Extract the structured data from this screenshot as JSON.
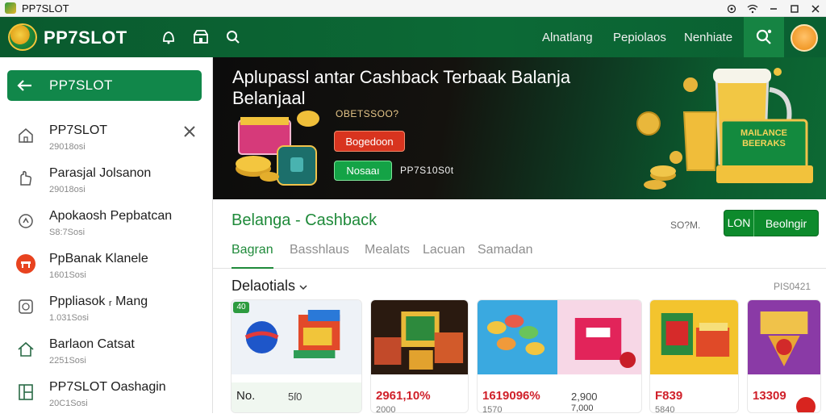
{
  "window": {
    "title": "PP7SLOT"
  },
  "header": {
    "logo": "PP7SLOT",
    "nav": [
      "Alnatlang",
      "Pepiolaos",
      "Nenhiate"
    ]
  },
  "sidebar": {
    "back_label": "PP7SLOT",
    "items": [
      {
        "name": "PP7SLOT",
        "sub": "29018osi",
        "icon": "home-icon"
      },
      {
        "name": "Parasjal Jolsanon",
        "sub": "29018osi",
        "icon": "hand-icon"
      },
      {
        "name": "Apokaosh Pepbatcan",
        "sub": "S8:7Sosi",
        "icon": "refresh-icon"
      },
      {
        "name": "PpBanak Klanele",
        "sub": "1601Sosi",
        "icon": "red-app-icon"
      },
      {
        "name": "Pppliasok ᵣ Mang",
        "sub": "1.031Sosi",
        "icon": "chat-icon"
      },
      {
        "name": "Barlaon Catsat",
        "sub": "2251Sosi",
        "icon": "house-outline-icon"
      },
      {
        "name": "PP7SLOT Oashagin",
        "sub": "20C1Sosi",
        "icon": "layout-icon"
      }
    ]
  },
  "banner": {
    "title": "Aplupassl antar Cashback Terbaak Balanja Belanjaal",
    "code": "OBETSSOO?",
    "btn1": "Bogedoon",
    "btn2": "Nosaaı",
    "code2": "PP7S10S0t",
    "poster_text": "MAILANCE BEERAKS"
  },
  "section": {
    "title": "Belanga - Cashback",
    "meta": "SO?M.",
    "btn_a": "LON",
    "btn_b": "Beolngir"
  },
  "tabs": [
    "Bagran",
    "Basshlaus",
    "Mealats",
    "Lacuan",
    "Samadan"
  ],
  "list": {
    "title": "Delaotials",
    "meta": "PIS0421"
  },
  "cards": [
    {
      "price": "No.",
      "price2": "5ſ0",
      "sub": "",
      "badge": "40"
    },
    {
      "price": "2961,10%",
      "price2": "",
      "sub": "2000"
    },
    {
      "price": "1619096%",
      "price2": "2,900",
      "price3": "7,000",
      "sub": "1570"
    },
    {
      "price": "F839",
      "price2": "",
      "sub": "5840"
    },
    {
      "price": "13309",
      "price2": "",
      "sub": ""
    }
  ],
  "colors": {
    "brand_green": "#0d6a34",
    "accent_green": "#1f8a3a",
    "cta_red": "#d8341f"
  }
}
